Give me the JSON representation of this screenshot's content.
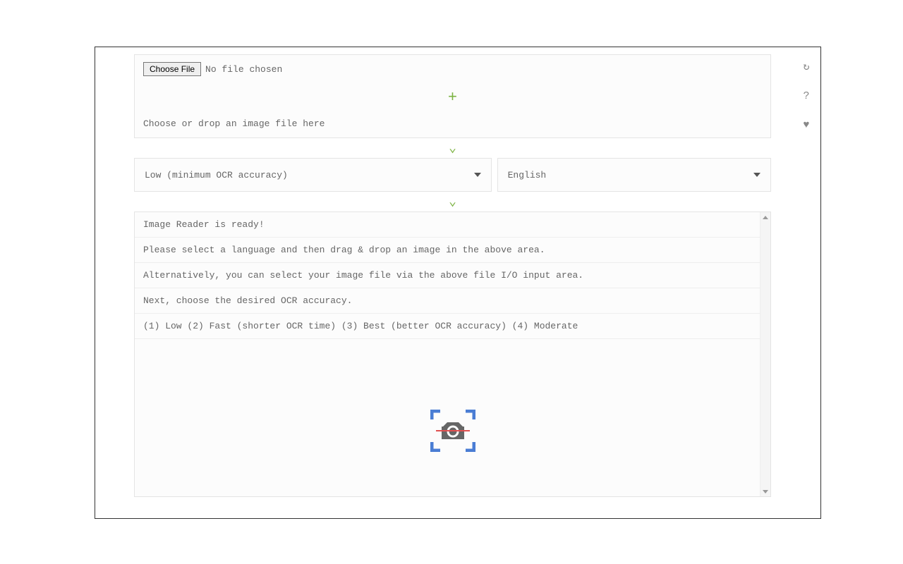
{
  "upload": {
    "choose_label": "Choose File",
    "no_file": "No file chosen",
    "drop_hint": "Choose or drop an image file here"
  },
  "selects": {
    "accuracy": "Low (minimum OCR accuracy)",
    "language": "English"
  },
  "log": {
    "items": [
      "Image Reader is ready!",
      "Please select a language and then drag & drop an image in the above area.",
      "Alternatively, you can select your image file via the above file I/O input area.",
      "Next, choose the desired OCR accuracy.",
      "(1) Low (2) Fast (shorter OCR time) (3) Best (better OCR accuracy) (4) Moderate"
    ]
  },
  "icons": {
    "plus": "+",
    "chevron": "⌄"
  }
}
